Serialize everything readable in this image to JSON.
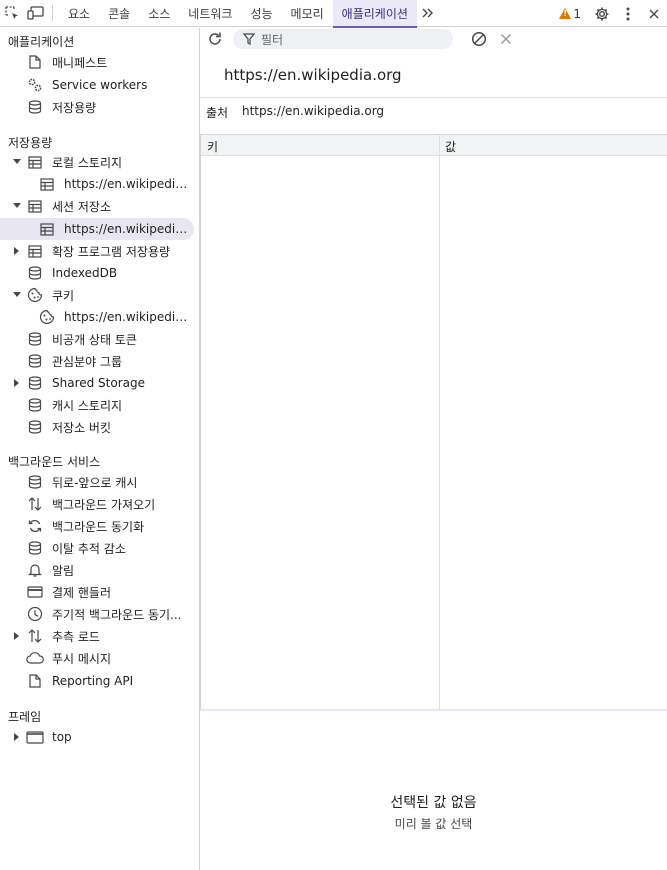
{
  "toolbar": {
    "tabs": [
      "요소",
      "콘솔",
      "소스",
      "네트워크",
      "성능",
      "메모리",
      "애플리케이션"
    ],
    "active_tab": "애플리케이션",
    "warning_count": "1"
  },
  "sidebar": {
    "sections": {
      "application": "애플리케이션",
      "storage": "저장용량",
      "background": "백그라운드 서비스",
      "frames": "프레임"
    },
    "application_items": [
      "매니페스트",
      "Service workers",
      "저장용량"
    ],
    "storage_items": {
      "local_storage": "로컬 스토리지",
      "local_storage_child": "https://en.wikipedia.o...",
      "session_storage": "세션 저장소",
      "session_storage_child": "https://en.wikipedia.o...",
      "extension_storage": "확장 프로그램 저장용량",
      "indexeddb": "IndexedDB",
      "cookies": "쿠키",
      "cookies_child": "https://en.wikipedia.o...",
      "private_state_tokens": "비공개 상태 토큰",
      "interest_groups": "관심분야 그룹",
      "shared_storage": "Shared Storage",
      "cache_storage": "캐시 스토리지",
      "storage_buckets": "저장소 버킷"
    },
    "background_items": {
      "bfcache": "뒤로-앞으로 캐시",
      "background_fetch": "백그라운드 가져오기",
      "background_sync": "백그라운드 동기화",
      "bounce_tracking": "이탈 추적 감소",
      "notifications": "알림",
      "payment_handler": "결제 핸들러",
      "periodic_sync": "주기적 백그라운드 동기...",
      "speculative_loads": "추측 로드",
      "push_messaging": "푸시 메시지",
      "reporting_api": "Reporting API"
    },
    "frames_items": [
      "top"
    ]
  },
  "main": {
    "filter_placeholder": "필터",
    "origin_title": "https://en.wikipedia.org",
    "origin_label": "출처",
    "origin_value": "https://en.wikipedia.org",
    "columns": [
      "키",
      "값"
    ],
    "empty_title": "선택된 값 없음",
    "empty_subtitle": "미리 볼 값 선택"
  }
}
